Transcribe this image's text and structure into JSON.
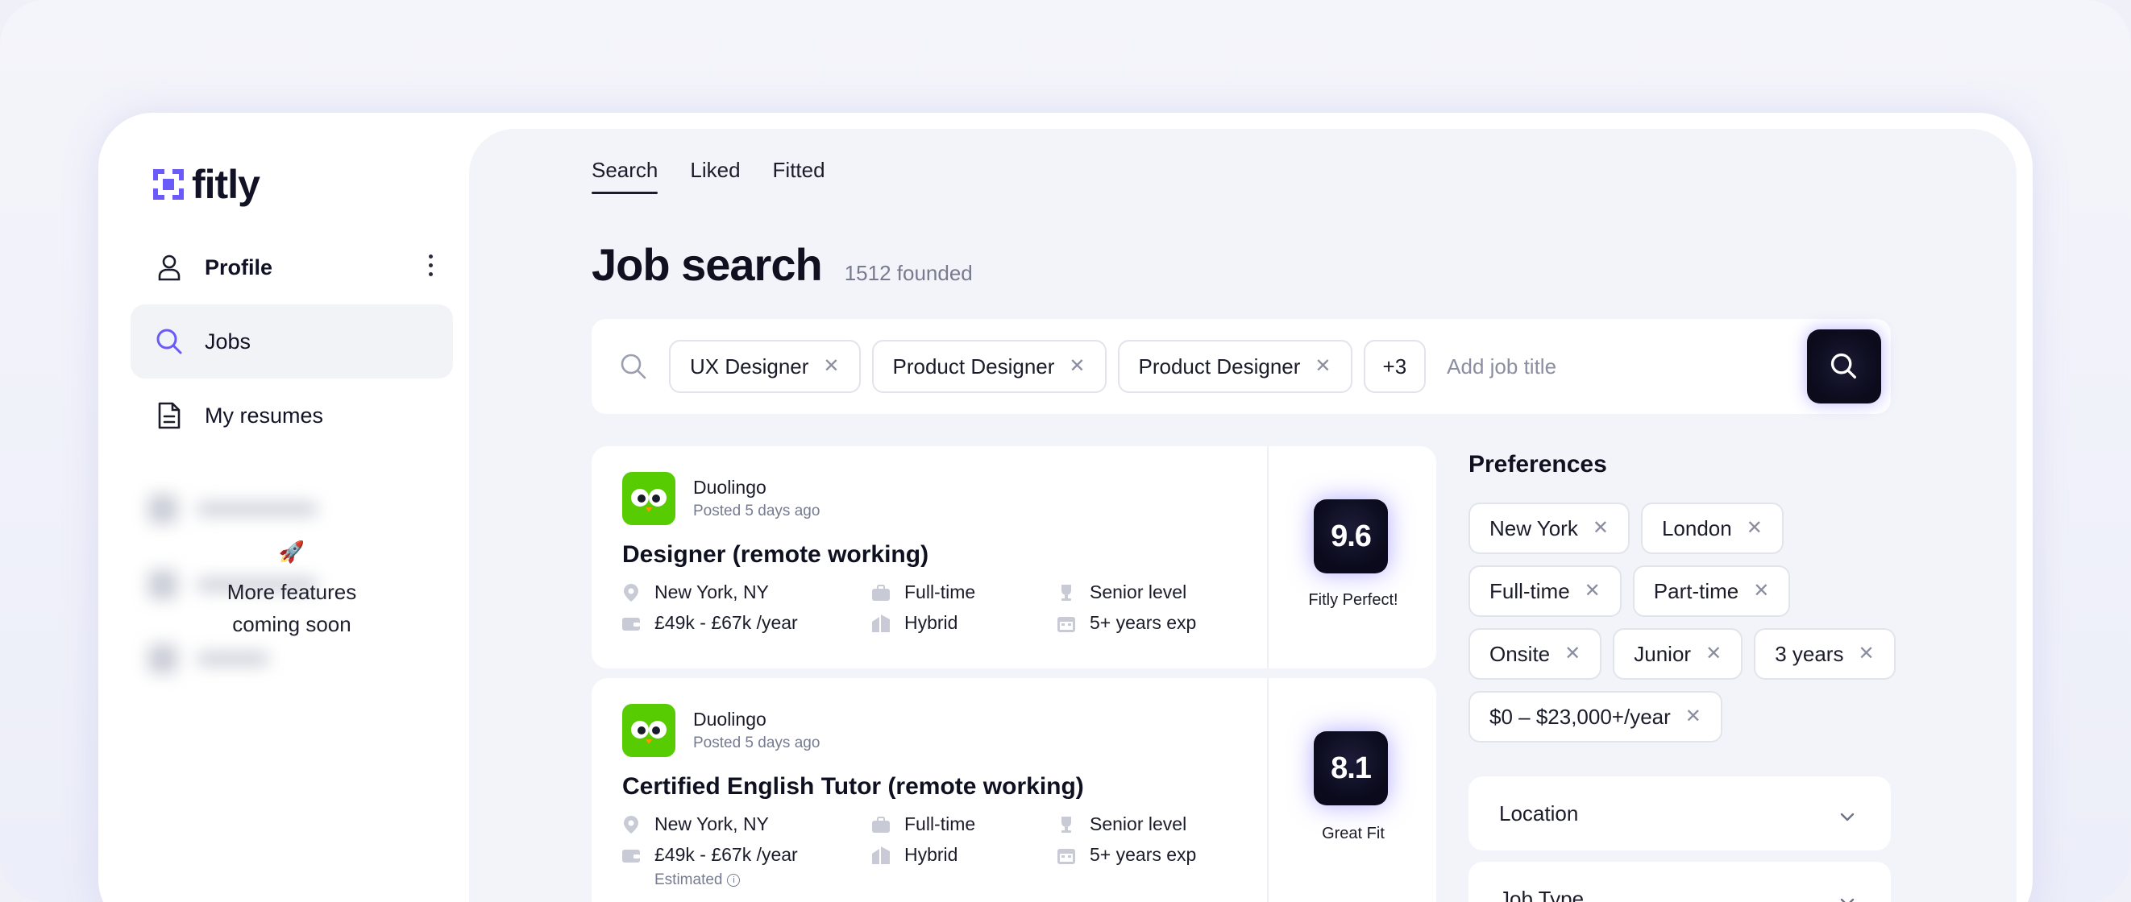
{
  "app": {
    "name": "fitly",
    "brand_color": "#6a5af9"
  },
  "sidebar": {
    "profile_label": "Profile",
    "items": [
      {
        "label": "Jobs",
        "icon": "search-icon",
        "active": true
      },
      {
        "label": "My resumes",
        "icon": "document-icon",
        "active": false
      }
    ],
    "coming_soon_emoji": "🚀",
    "coming_soon_line1": "More features",
    "coming_soon_line2": "coming soon"
  },
  "tabs": [
    {
      "label": "Search",
      "active": true
    },
    {
      "label": "Liked",
      "active": false
    },
    {
      "label": "Fitted",
      "active": false
    }
  ],
  "header": {
    "title": "Job search",
    "count": "1512 founded"
  },
  "search": {
    "chips": [
      "UX Designer",
      "Product Designer",
      "Product Designer"
    ],
    "more": "+3",
    "placeholder": "Add job title"
  },
  "jobs": [
    {
      "company": "Duolingo",
      "posted": "Posted 5 days ago",
      "title": "Designer (remote working)",
      "location": "New York, NY",
      "salary": "£49k - £67k /year",
      "type": "Full-time",
      "mode": "Hybrid",
      "level": "Senior level",
      "experience": "5+ years exp",
      "score": "9.6",
      "score_label": "Fitly Perfect!"
    },
    {
      "company": "Duolingo",
      "posted": "Posted 5 days ago",
      "title": "Certified English Tutor (remote working)",
      "location": "New York, NY",
      "salary": "£49k - £67k /year",
      "salary_note": "Estimated",
      "type": "Full-time",
      "mode": "Hybrid",
      "level": "Senior level",
      "experience": "5+ years exp",
      "score": "8.1",
      "score_label": "Great Fit"
    }
  ],
  "preferences": {
    "title": "Preferences",
    "rows": [
      [
        "New York",
        "London"
      ],
      [
        "Full-time",
        "Part-time"
      ],
      [
        "Onsite",
        "Junior",
        "3 years"
      ],
      [
        "$0 – $23,000+/year"
      ]
    ],
    "sections": [
      "Location",
      "Job Type"
    ]
  }
}
